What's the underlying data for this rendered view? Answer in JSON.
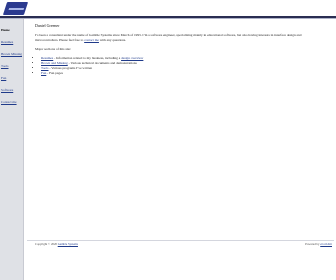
{
  "sidebar": {
    "items": [
      {
        "label": "Home",
        "current": true
      },
      {
        "label": "Resumes"
      },
      {
        "label": "Brown Missing"
      },
      {
        "label": "Tools"
      },
      {
        "label": "Fun"
      },
      {
        "label": "Software"
      },
      {
        "label": "Contact me"
      }
    ]
  },
  "main": {
    "title": "Daniel Greener",
    "intro": "I’s been a consultant under the name of Gamble Systems since March of 1993. I’m a software engineer, specializing mainly in educational software, but also having interests in interface design and microcontrollers. Please feel free to",
    "intro_link": "contact me",
    "intro_end": "with any questions.",
    "sections_heading": "Major sections of this site:",
    "sections": [
      {
        "link": "Resumes",
        "text": " - Information related to my business, including a",
        "sublink": "design overview"
      },
      {
        "link": "Brown and Missing",
        "text": " - Various technical documents and demonstrations",
        "sublink": ""
      },
      {
        "link": "Tools",
        "text": " - Various programs I’ve written",
        "sublink": ""
      },
      {
        "link": "Fun",
        "text": " - Fun pages",
        "sublink": ""
      }
    ]
  },
  "footer": {
    "left_text": "Copyright © 2020",
    "left_link": "Gamble Systems",
    "right_text": "Powered by",
    "right_link": "eCom Kit"
  }
}
